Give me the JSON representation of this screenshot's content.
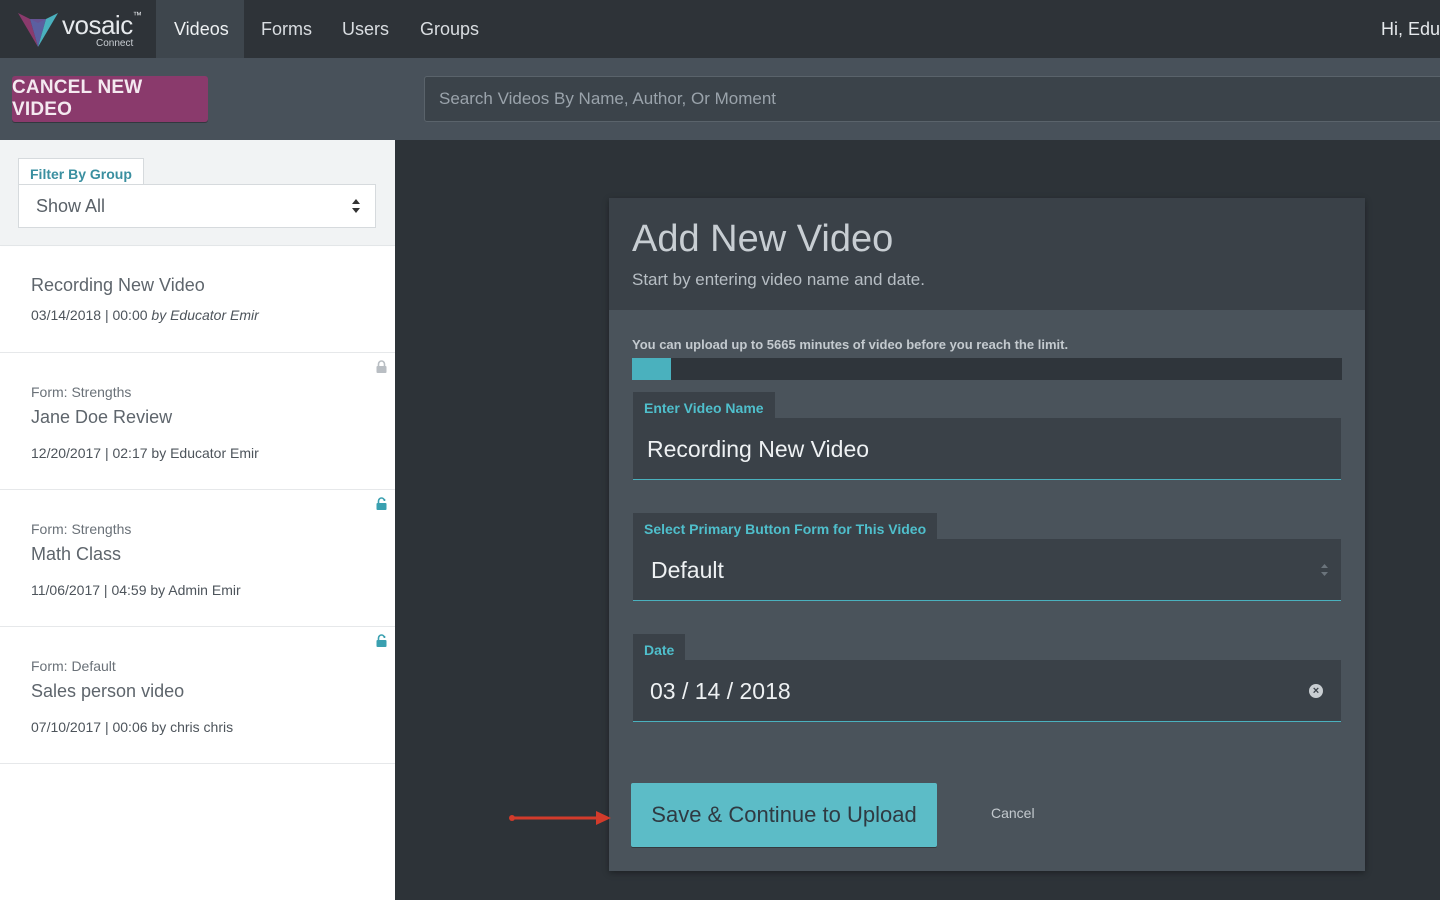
{
  "header": {
    "logo_text": "vosaic",
    "logo_tm": "™",
    "logo_sub": "Connect",
    "nav": [
      {
        "label": "Videos",
        "active": true
      },
      {
        "label": "Forms",
        "active": false
      },
      {
        "label": "Users",
        "active": false
      },
      {
        "label": "Groups",
        "active": false
      }
    ],
    "greeting": "Hi, Edu"
  },
  "toolbar": {
    "cancel_label": "CANCEL NEW VIDEO",
    "search_placeholder": "Search Videos By Name, Author, Or Moment"
  },
  "sidebar": {
    "filter_label": "Filter By Group",
    "filter_value": "Show All",
    "items": [
      {
        "form": "",
        "title": "Recording New Video",
        "date": "03/14/2018 | 00:00",
        "author": "by Educator Emir",
        "locked": null
      },
      {
        "form": "Form: Strengths",
        "title": "Jane Doe Review",
        "date": "12/20/2017 | 02:17",
        "author": "by Educator Emir",
        "locked": "locked"
      },
      {
        "form": "Form: Strengths",
        "title": "Math Class",
        "date": "11/06/2017 | 04:59",
        "author": "by Admin Emir",
        "locked": "unlocked"
      },
      {
        "form": "Form: Default",
        "title": "Sales person video",
        "date": "07/10/2017 | 00:06",
        "author": "by chris chris",
        "locked": "unlocked"
      }
    ]
  },
  "panel": {
    "title": "Add New Video",
    "subtitle": "Start by entering video name and date.",
    "limit_text": "You can upload up to 5665 minutes of video before you reach the limit.",
    "usage_fraction": 0.055,
    "name_label": "Enter Video Name",
    "name_value": "Recording New Video",
    "form_label": "Select Primary Button Form for This Video",
    "form_value": "Default",
    "date_label": "Date",
    "date_value": "03 / 14 / 2018",
    "save_label": "Save & Continue to Upload",
    "cancel_label": "Cancel"
  },
  "colors": {
    "accent": "#4ab1be",
    "cancel_button": "#8a3a6c",
    "annotation_arrow": "#d23b2b"
  }
}
